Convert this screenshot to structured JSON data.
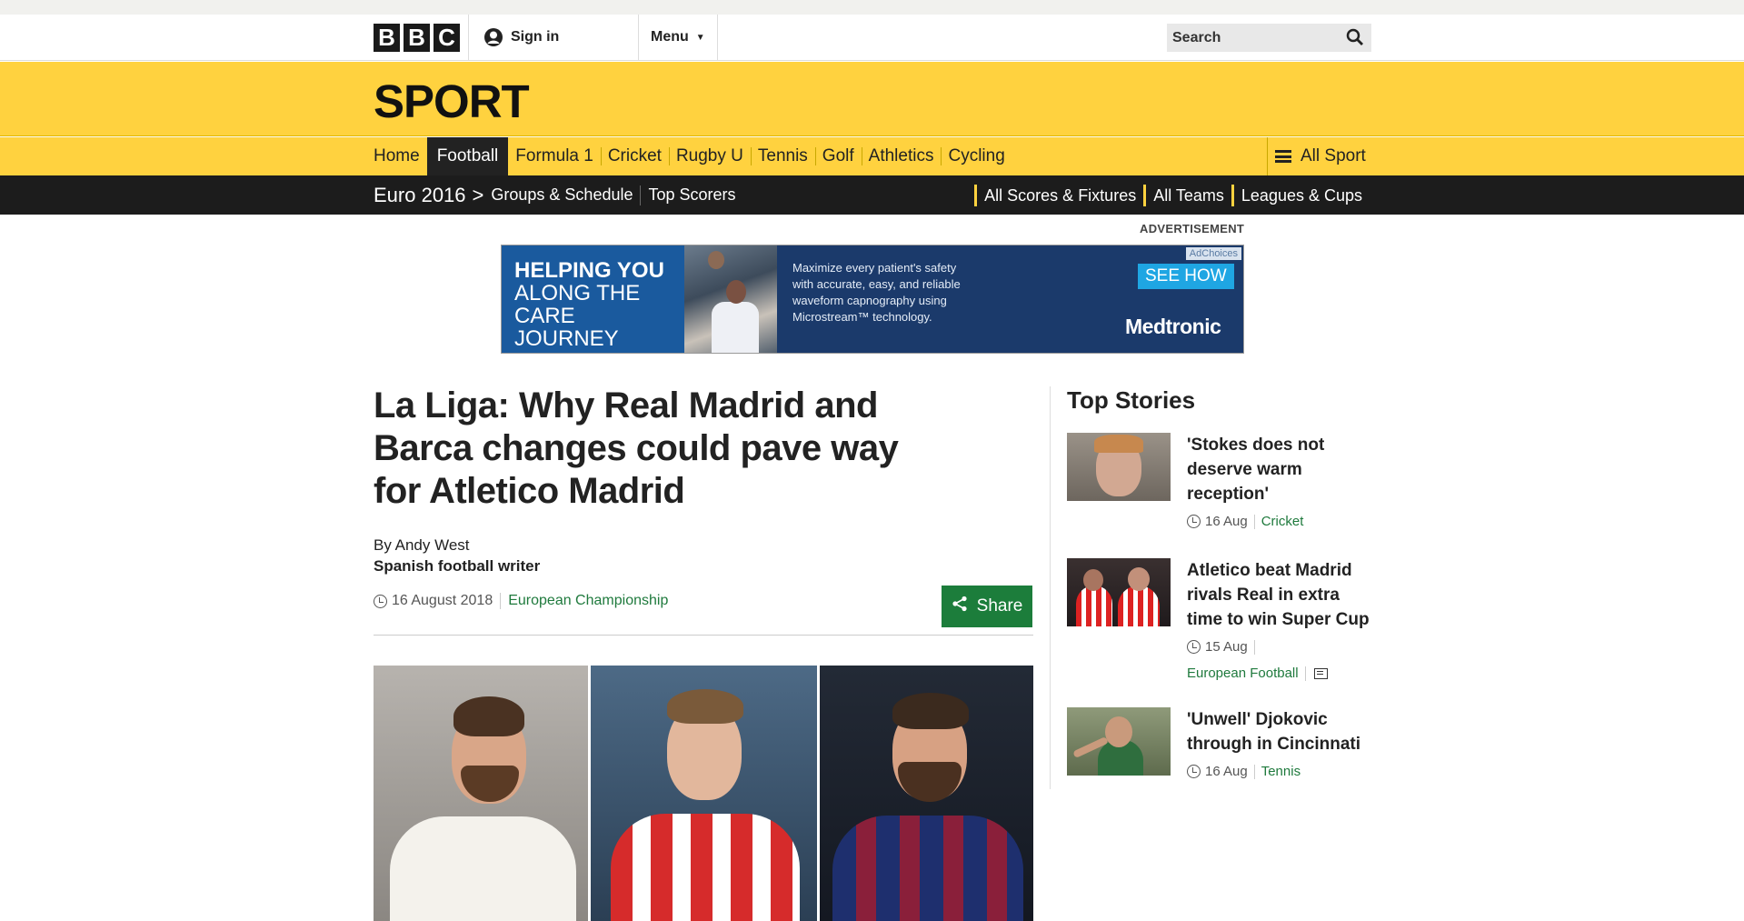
{
  "header": {
    "logo": [
      "B",
      "B",
      "C"
    ],
    "sign_in": "Sign in",
    "menu": "Menu",
    "search_placeholder": "Search"
  },
  "section": {
    "title": "SPORT"
  },
  "sport_nav": {
    "items": [
      "Home",
      "Football",
      "Formula 1",
      "Cricket",
      "Rugby U",
      "Tennis",
      "Golf",
      "Athletics",
      "Cycling"
    ],
    "active": "Football",
    "all_sport": "All Sport"
  },
  "sub_nav": {
    "title": "Euro 2016",
    "left_links": [
      "Groups & Schedule",
      "Top Scorers"
    ],
    "right_links": [
      "All Scores & Fixtures",
      "All Teams",
      "Leagues & Cups"
    ]
  },
  "advert": {
    "label": "ADVERTISEMENT",
    "headline_bold": "HELPING YOU",
    "headline_rest": [
      "ALONG THE",
      "CARE JOURNEY"
    ],
    "copy": "Maximize every patient's safety with accurate, easy, and reliable waveform capnography using Microstream™ technology.",
    "choices": "AdChoices",
    "cta": "SEE HOW",
    "brand": "Medtronic"
  },
  "article": {
    "title": "La Liga: Why Real Madrid and Barca changes could pave way for Atletico Madrid",
    "author": "By Andy West",
    "role": "Spanish football writer",
    "date": "16 August 2018",
    "category": "European Championship",
    "share": "Share"
  },
  "sidebar": {
    "heading": "Top Stories",
    "stories": [
      {
        "title": "'Stokes does not deserve warm reception'",
        "date": "16 Aug",
        "category": "Cricket"
      },
      {
        "title": "Atletico beat Madrid rivals Real in extra time to win Super Cup",
        "date": "15 Aug",
        "category": "European Football"
      },
      {
        "title": "'Unwell' Djokovic through in Cincinnati",
        "date": "16 Aug",
        "category": "Tennis"
      }
    ]
  },
  "colors": {
    "sport_yellow": "#ffd23f",
    "bar_black": "#1c1c1c",
    "share_green": "#1c7d3b",
    "link_green": "#1f7a3d"
  }
}
